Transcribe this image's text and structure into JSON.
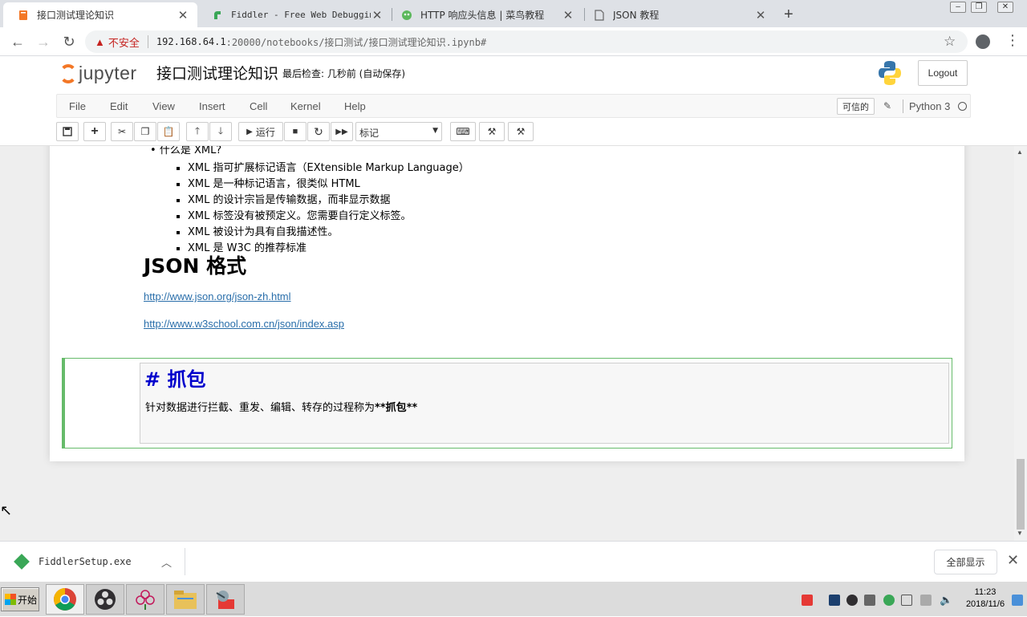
{
  "browser": {
    "tabs": [
      {
        "title": "接口测试理论知识",
        "favicon": "notebook-icon",
        "active": true
      },
      {
        "title": "Fiddler - Free Web Debugging",
        "favicon": "fiddler-icon",
        "active": false
      },
      {
        "title": "HTTP 响应头信息 | 菜鸟教程",
        "favicon": "runoob-icon",
        "active": false
      },
      {
        "title": "JSON 教程",
        "favicon": "page-icon",
        "active": false
      }
    ],
    "new_tab_label": "+",
    "security_label": "不安全",
    "url_host": "192.168.64.1",
    "url_path": ":20000/notebooks/接口测试/接口测试理论知识.ipynb#"
  },
  "jupyter": {
    "logo_text": "jupyter",
    "notebook_title": "接口测试理论知识",
    "checkpoint": "最后检查: 几秒前  (自动保存)",
    "logout_label": "Logout",
    "menu": [
      "File",
      "Edit",
      "View",
      "Insert",
      "Cell",
      "Kernel",
      "Help"
    ],
    "trusted_label": "可信的",
    "kernel_name": "Python 3",
    "run_label": "运行",
    "cell_type": "标记"
  },
  "notebook": {
    "xml_partial": "什么是 XML?",
    "xml_items": [
      "XML 指可扩展标记语言（EXtensible Markup Language）",
      "XML 是一种标记语言，很类似 HTML",
      "XML 的设计宗旨是传输数据，而非显示数据",
      "XML 标签没有被预定义。您需要自行定义标签。",
      "XML 被设计为具有自我描述性。",
      "XML 是 W3C 的推荐标准"
    ],
    "json_heading": "JSON 格式",
    "links": [
      "http://www.json.org/json-zh.html",
      "http://www.w3school.com.cn/json/index.asp"
    ],
    "editor_heading": "# 抓包",
    "editor_text_prefix": "针对数据进行拦截、重发、编辑、转存的过程称为",
    "editor_text_bold": "**抓包**"
  },
  "downloads": {
    "file_name": "FiddlerSetup.exe",
    "show_all_label": "全部显示"
  },
  "taskbar": {
    "start_label": "开始",
    "apps": [
      "chrome-icon",
      "obs-icon",
      "flower-icon",
      "explorer-icon",
      "tool-icon"
    ],
    "time": "11:23",
    "date": "2018/11/6"
  },
  "colors": {
    "jupyter_orange": "#f37726",
    "selected_cell_border": "#66bb6a",
    "heading_blue": "#0000cc",
    "link_blue": "#296eaa",
    "insecure_red": "#c5221f"
  }
}
